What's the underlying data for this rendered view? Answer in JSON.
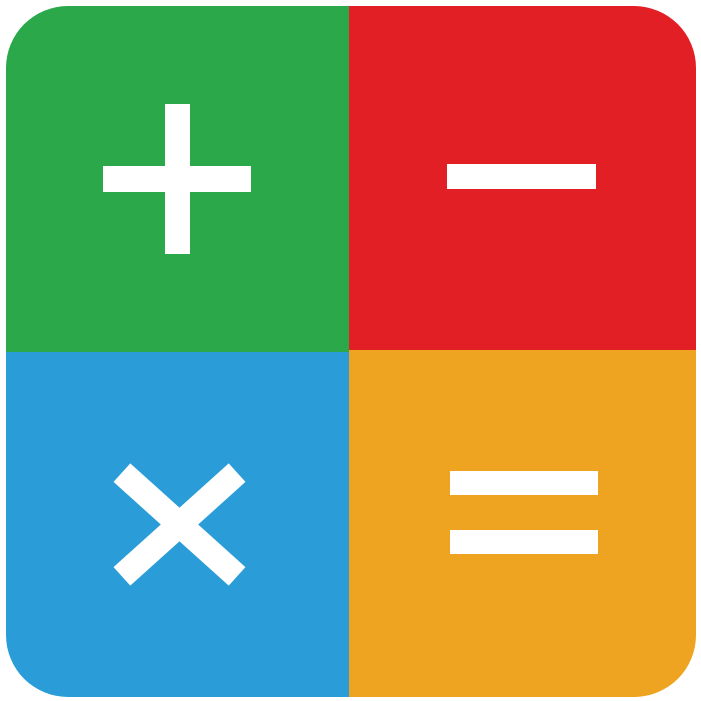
{
  "app_icon": {
    "quadrants": [
      {
        "name": "plus",
        "icon": "plus-icon",
        "color": "#2aa84a"
      },
      {
        "name": "minus",
        "icon": "minus-icon",
        "color": "#e31f26"
      },
      {
        "name": "times",
        "icon": "times-icon",
        "color": "#2a9cd8"
      },
      {
        "name": "equals",
        "icon": "equals-icon",
        "color": "#eea421"
      }
    ],
    "symbol_color": "#ffffff"
  }
}
